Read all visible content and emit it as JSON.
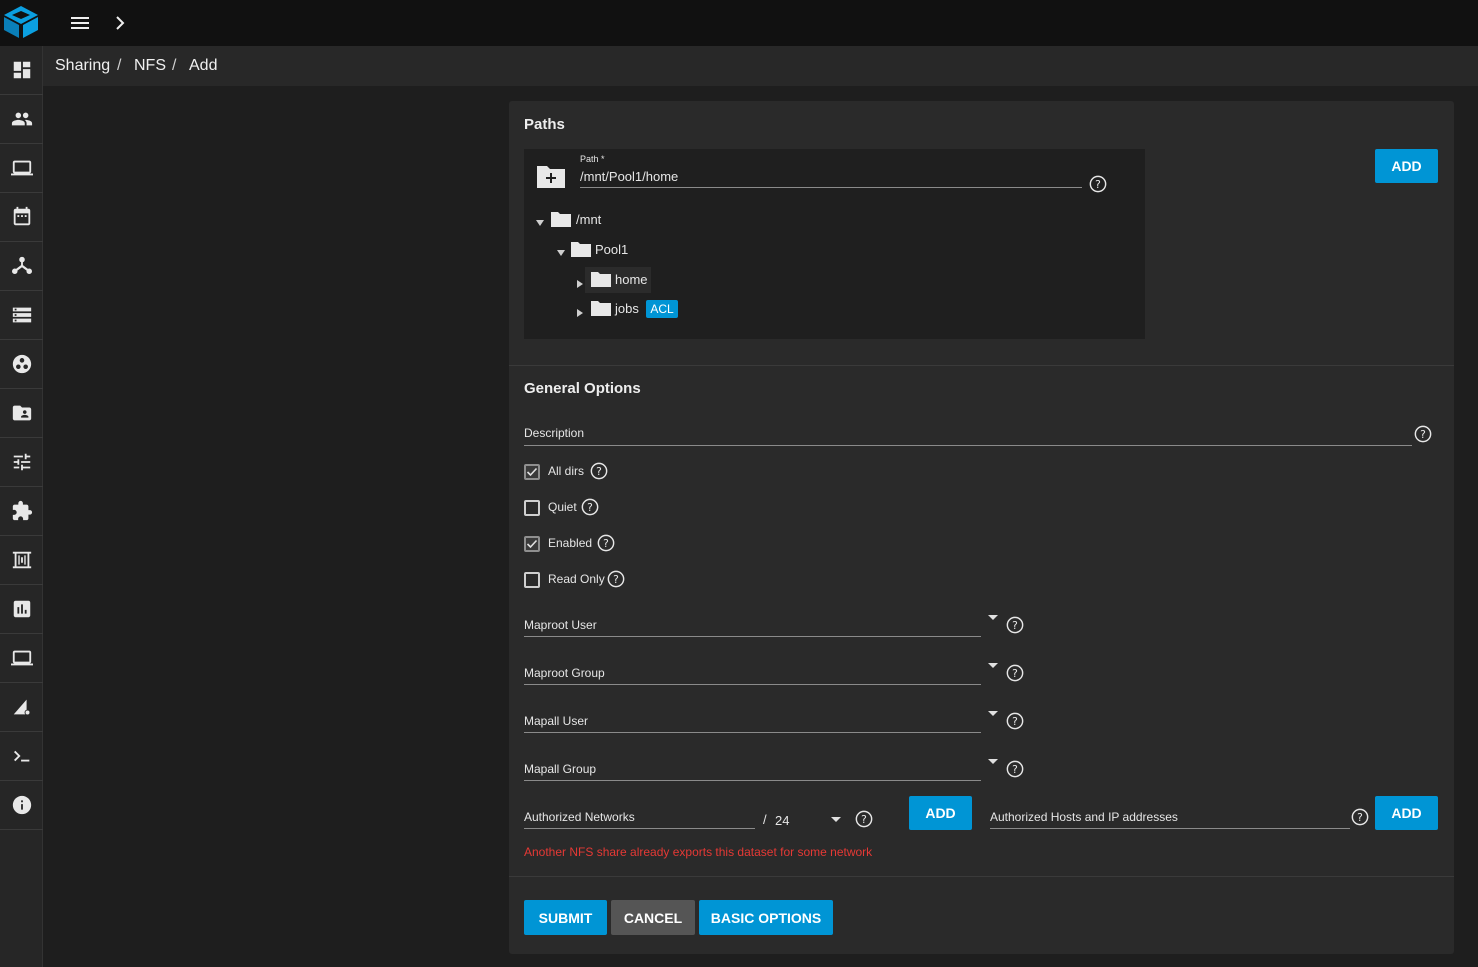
{
  "breadcrumb": {
    "items": [
      "Sharing",
      "NFS",
      "Add"
    ],
    "separator": "/"
  },
  "paths": {
    "title": "Paths",
    "path_label": "Path *",
    "path_value": "/mnt/Pool1/home",
    "add_label": "ADD",
    "tree": {
      "root": "/mnt",
      "pool": "Pool1",
      "children": [
        {
          "name": "home"
        },
        {
          "name": "jobs",
          "badge": "ACL"
        }
      ]
    }
  },
  "general": {
    "title": "General Options",
    "description_label": "Description",
    "checkboxes": [
      {
        "label": "All dirs",
        "checked": true
      },
      {
        "label": "Quiet",
        "checked": false
      },
      {
        "label": "Enabled",
        "checked": true
      },
      {
        "label": "Read Only",
        "checked": false
      }
    ],
    "selects": [
      {
        "label": "Maproot User"
      },
      {
        "label": "Maproot Group"
      },
      {
        "label": "Mapall User"
      },
      {
        "label": "Mapall Group"
      }
    ],
    "networks": {
      "label": "Authorized Networks",
      "slash": "/",
      "mask": "24",
      "add_label": "ADD",
      "error": "Another NFS share already exports this dataset for some network"
    },
    "hosts": {
      "label": "Authorized Hosts and IP addresses",
      "add_label": "ADD"
    }
  },
  "actions": {
    "submit": "SUBMIT",
    "cancel": "CANCEL",
    "basic": "BASIC OPTIONS"
  },
  "colors": {
    "accent": "#0095d5",
    "error": "#e53935",
    "badge": "#0095d5"
  },
  "sidebar_icons": [
    "dashboard-icon",
    "accounts-icon",
    "system-icon",
    "tasks-icon",
    "network-icon",
    "storage-icon",
    "directory-services-icon",
    "sharing-icon",
    "services-icon",
    "plugins-icon",
    "jails-icon",
    "reporting-icon",
    "virtual-machines-icon",
    "display-system-processes-icon",
    "shell-icon",
    "guide-icon"
  ]
}
